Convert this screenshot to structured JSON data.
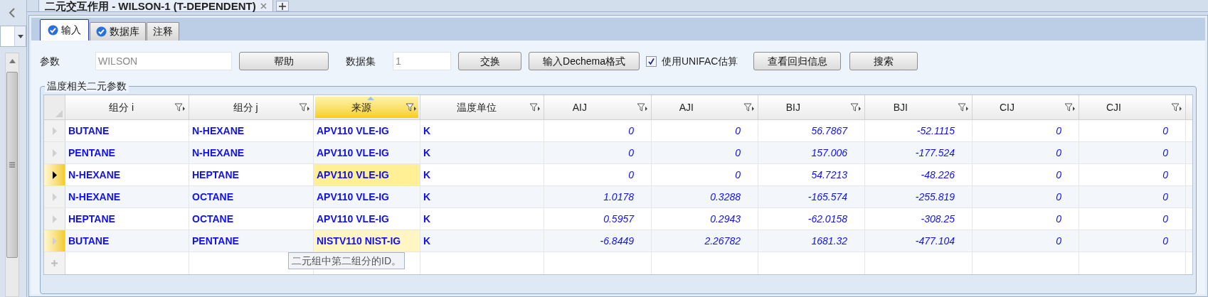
{
  "document_tab": {
    "title": "二元交互作用 - WILSON-1 (T-DEPENDENT)"
  },
  "tabs": [
    {
      "label": "输入",
      "selected": true,
      "checked": true
    },
    {
      "label": "数据库",
      "selected": false,
      "checked": true
    },
    {
      "label": "注释",
      "selected": false,
      "checked": false
    }
  ],
  "toolbar": {
    "parameter_label": "参数",
    "parameter_value": "WILSON",
    "help_button": "帮助",
    "dataset_label": "数据集",
    "dataset_value": "1",
    "swap_button": "交换",
    "dechema_button": "输入Dechema格式",
    "unifac": {
      "label": "使用UNIFAC估算",
      "checked": true
    },
    "regression_button": "查看回归信息",
    "search_button": "搜索"
  },
  "group_title": "温度相关二元参数",
  "table": {
    "columns": [
      {
        "label": "组分 i",
        "active": false,
        "kind": "text"
      },
      {
        "label": "组分 j",
        "active": false,
        "kind": "text"
      },
      {
        "label": "来源",
        "active": true,
        "kind": "text"
      },
      {
        "label": "温度单位",
        "active": false,
        "kind": "text"
      },
      {
        "label": "AIJ",
        "active": false,
        "kind": "number"
      },
      {
        "label": "AJI",
        "active": false,
        "kind": "number"
      },
      {
        "label": "BIJ",
        "active": false,
        "kind": "number"
      },
      {
        "label": "BJI",
        "active": false,
        "kind": "number"
      },
      {
        "label": "CIJ",
        "active": false,
        "kind": "number"
      },
      {
        "label": "CJI",
        "active": false,
        "kind": "number"
      }
    ],
    "rows": [
      {
        "selected": false,
        "hovered": false,
        "cells": [
          "BUTANE",
          "N-HEXANE",
          "APV110 VLE-IG",
          "K",
          "0",
          "0",
          "56.7867",
          "-52.1115",
          "0",
          "0"
        ]
      },
      {
        "selected": false,
        "hovered": false,
        "cells": [
          "PENTANE",
          "N-HEXANE",
          "APV110 VLE-IG",
          "K",
          "0",
          "0",
          "157.006",
          "-177.524",
          "0",
          "0"
        ]
      },
      {
        "selected": true,
        "hovered": false,
        "cells": [
          "N-HEXANE",
          "HEPTANE",
          "APV110 VLE-IG",
          "K",
          "0",
          "0",
          "54.7213",
          "-48.226",
          "0",
          "0"
        ]
      },
      {
        "selected": false,
        "hovered": false,
        "cells": [
          "N-HEXANE",
          "OCTANE",
          "APV110 VLE-IG",
          "K",
          "1.0178",
          "0.3288",
          "-165.574",
          "-255.819",
          "0",
          "0"
        ]
      },
      {
        "selected": false,
        "hovered": false,
        "cells": [
          "HEPTANE",
          "OCTANE",
          "APV110 VLE-IG",
          "K",
          "0.5957",
          "0.2943",
          "-62.0158",
          "-308.25",
          "0",
          "0"
        ]
      },
      {
        "selected": false,
        "hovered": true,
        "cells": [
          "BUTANE",
          "PENTANE",
          "NISTV110 NIST-IG",
          "K",
          "-6.8449",
          "2.26782",
          "1681.32",
          "-477.104",
          "0",
          "0"
        ]
      }
    ],
    "tooltip": "二元组中第二组分的ID。"
  }
}
